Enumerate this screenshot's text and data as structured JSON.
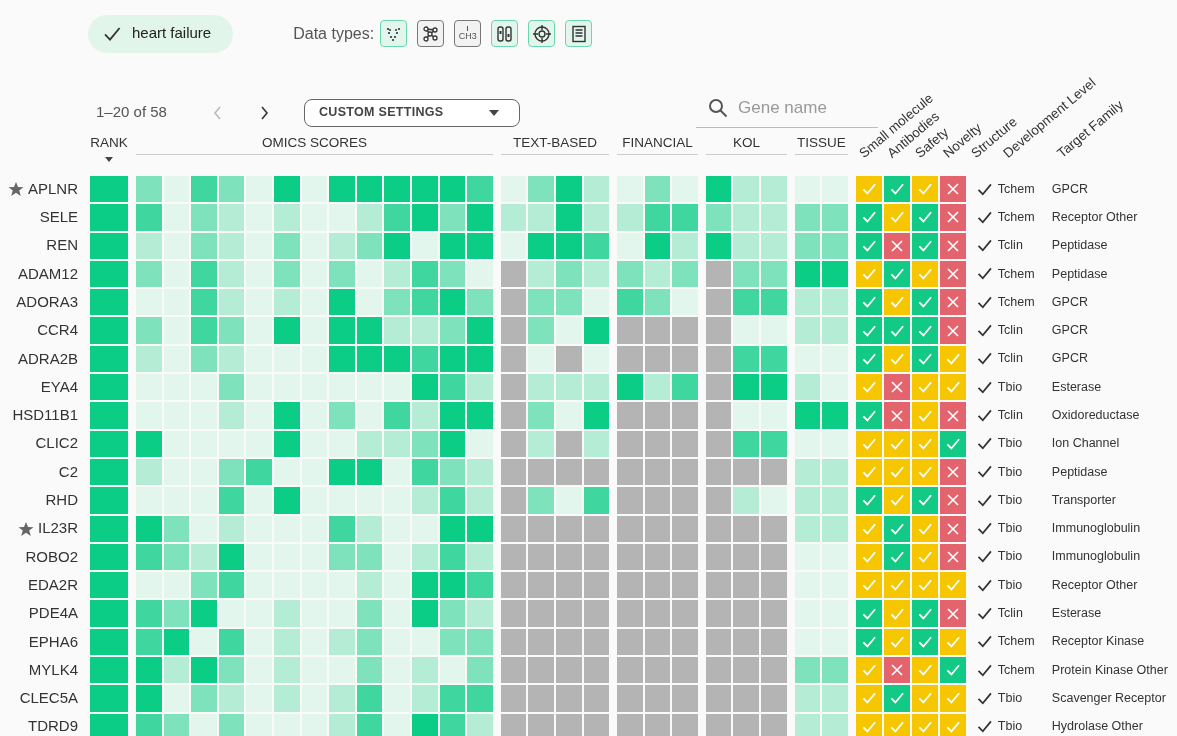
{
  "condition": {
    "label": "heart failure",
    "selected": true
  },
  "data_types_label": "Data types:",
  "data_types": [
    {
      "kind": "volcano",
      "selected": true
    },
    {
      "kind": "network",
      "selected": false
    },
    {
      "kind": "methyl",
      "label": "CH3",
      "selected": false
    },
    {
      "kind": "blots",
      "selected": true
    },
    {
      "kind": "target",
      "selected": true
    },
    {
      "kind": "document",
      "selected": true
    }
  ],
  "pagination": {
    "range": "1–20 of 58",
    "prev_disabled": true,
    "next_disabled": false
  },
  "settings_dropdown": {
    "label": "CUSTOM SETTINGS"
  },
  "search": {
    "placeholder": "Gene name"
  },
  "column_groups": [
    {
      "label": "RANK",
      "sorted": true
    },
    {
      "label": "OMICS SCORES",
      "sorted": false
    },
    {
      "label": "TEXT-BASED",
      "sorted": false
    },
    {
      "label": "FINANCIAL",
      "sorted": false
    },
    {
      "label": "KOL",
      "sorted": false
    },
    {
      "label": "TISSUE",
      "sorted": false
    }
  ],
  "rotated_headers": [
    "Small molecule",
    "Antibodies",
    "Safety",
    "Novelty",
    "Structure",
    "Development Level",
    "Target Family"
  ],
  "rows": [
    {
      "gene": "APLNR",
      "starred": true,
      "rank": {
        "kind": "full"
      },
      "omics": [
        {
          "kind": "medium"
        },
        {
          "kind": "faint"
        },
        {
          "kind": "strong"
        },
        {
          "kind": "medium"
        },
        {
          "kind": "faint"
        },
        {
          "kind": "full"
        },
        {
          "kind": "faint"
        },
        {
          "kind": "full"
        },
        {
          "kind": "full"
        },
        {
          "kind": "full"
        },
        {
          "kind": "full"
        },
        {
          "kind": "full"
        },
        {
          "kind": "strong"
        }
      ],
      "text_based": [
        {
          "kind": "faint"
        },
        {
          "kind": "medium"
        },
        {
          "kind": "full"
        },
        {
          "kind": "light"
        }
      ],
      "financial": [
        {
          "kind": "faint"
        },
        {
          "kind": "medium"
        },
        {
          "kind": "faint"
        }
      ],
      "kol": [
        {
          "kind": "full"
        },
        {
          "kind": "light"
        },
        {
          "kind": "light"
        }
      ],
      "tissue": [
        {
          "kind": "faint"
        },
        {
          "kind": "faint"
        }
      ],
      "tractability": [
        {
          "kind": "fair"
        },
        {
          "kind": "good"
        },
        {
          "kind": "fair"
        },
        {
          "kind": "none"
        }
      ],
      "structure_checked": true,
      "development_level": "Tchem",
      "target_family": "GPCR"
    },
    {
      "gene": "SELE",
      "starred": false,
      "rank": {
        "kind": "full"
      },
      "omics": [
        {
          "kind": "strong"
        },
        {
          "kind": "faint"
        },
        {
          "kind": "medium"
        },
        {
          "kind": "light"
        },
        {
          "kind": "faint"
        },
        {
          "kind": "light"
        },
        {
          "kind": "faint"
        },
        {
          "kind": "faint"
        },
        {
          "kind": "light"
        },
        {
          "kind": "strong"
        },
        {
          "kind": "full"
        },
        {
          "kind": "medium"
        },
        {
          "kind": "full"
        }
      ],
      "text_based": [
        {
          "kind": "light"
        },
        {
          "kind": "light"
        },
        {
          "kind": "full"
        },
        {
          "kind": "light"
        }
      ],
      "financial": [
        {
          "kind": "light"
        },
        {
          "kind": "strong"
        },
        {
          "kind": "strong"
        }
      ],
      "kol": [
        {
          "kind": "medium"
        },
        {
          "kind": "light"
        },
        {
          "kind": "light"
        }
      ],
      "tissue": [
        {
          "kind": "medium"
        },
        {
          "kind": "medium"
        }
      ],
      "tractability": [
        {
          "kind": "good"
        },
        {
          "kind": "fair"
        },
        {
          "kind": "good"
        },
        {
          "kind": "none"
        }
      ],
      "structure_checked": true,
      "development_level": "Tchem",
      "target_family": "Receptor Other"
    },
    {
      "gene": "REN",
      "starred": false,
      "rank": {
        "kind": "full"
      },
      "omics": [
        {
          "kind": "light"
        },
        {
          "kind": "faint"
        },
        {
          "kind": "medium"
        },
        {
          "kind": "light"
        },
        {
          "kind": "faint"
        },
        {
          "kind": "medium"
        },
        {
          "kind": "faint"
        },
        {
          "kind": "light"
        },
        {
          "kind": "medium"
        },
        {
          "kind": "full"
        },
        {
          "kind": "faint"
        },
        {
          "kind": "full"
        },
        {
          "kind": "full"
        }
      ],
      "text_based": [
        {
          "kind": "faint"
        },
        {
          "kind": "full"
        },
        {
          "kind": "full"
        },
        {
          "kind": "strong"
        }
      ],
      "financial": [
        {
          "kind": "faint"
        },
        {
          "kind": "full"
        },
        {
          "kind": "light"
        }
      ],
      "kol": [
        {
          "kind": "full"
        },
        {
          "kind": "light"
        },
        {
          "kind": "light"
        }
      ],
      "tissue": [
        {
          "kind": "medium"
        },
        {
          "kind": "medium"
        }
      ],
      "tractability": [
        {
          "kind": "good"
        },
        {
          "kind": "none"
        },
        {
          "kind": "good"
        },
        {
          "kind": "none"
        }
      ],
      "structure_checked": true,
      "development_level": "Tclin",
      "target_family": "Peptidase"
    },
    {
      "gene": "ADAM12",
      "starred": false,
      "rank": {
        "kind": "full"
      },
      "omics": [
        {
          "kind": "medium"
        },
        {
          "kind": "faint"
        },
        {
          "kind": "strong"
        },
        {
          "kind": "light"
        },
        {
          "kind": "faint"
        },
        {
          "kind": "medium"
        },
        {
          "kind": "faint"
        },
        {
          "kind": "medium"
        },
        {
          "kind": "faint"
        },
        {
          "kind": "light"
        },
        {
          "kind": "strong"
        },
        {
          "kind": "medium"
        },
        {
          "kind": "faint"
        }
      ],
      "text_based": [
        {
          "kind": "none"
        },
        {
          "kind": "light"
        },
        {
          "kind": "medium"
        },
        {
          "kind": "light"
        }
      ],
      "financial": [
        {
          "kind": "medium"
        },
        {
          "kind": "light"
        },
        {
          "kind": "medium"
        }
      ],
      "kol": [
        {
          "kind": "none"
        },
        {
          "kind": "medium"
        },
        {
          "kind": "medium"
        }
      ],
      "tissue": [
        {
          "kind": "full"
        },
        {
          "kind": "full"
        }
      ],
      "tractability": [
        {
          "kind": "fair"
        },
        {
          "kind": "good"
        },
        {
          "kind": "fair"
        },
        {
          "kind": "none"
        }
      ],
      "structure_checked": true,
      "development_level": "Tchem",
      "target_family": "Peptidase"
    },
    {
      "gene": "ADORA3",
      "starred": false,
      "rank": {
        "kind": "full"
      },
      "omics": [
        {
          "kind": "faint"
        },
        {
          "kind": "faint"
        },
        {
          "kind": "strong"
        },
        {
          "kind": "light"
        },
        {
          "kind": "faint"
        },
        {
          "kind": "light"
        },
        {
          "kind": "faint"
        },
        {
          "kind": "full"
        },
        {
          "kind": "faint"
        },
        {
          "kind": "medium"
        },
        {
          "kind": "strong"
        },
        {
          "kind": "full"
        },
        {
          "kind": "medium"
        }
      ],
      "text_based": [
        {
          "kind": "none"
        },
        {
          "kind": "medium"
        },
        {
          "kind": "medium"
        },
        {
          "kind": "faint"
        }
      ],
      "financial": [
        {
          "kind": "strong"
        },
        {
          "kind": "medium"
        },
        {
          "kind": "faint"
        }
      ],
      "kol": [
        {
          "kind": "none"
        },
        {
          "kind": "strong"
        },
        {
          "kind": "strong"
        }
      ],
      "tissue": [
        {
          "kind": "light"
        },
        {
          "kind": "light"
        }
      ],
      "tractability": [
        {
          "kind": "good"
        },
        {
          "kind": "fair"
        },
        {
          "kind": "good"
        },
        {
          "kind": "none"
        }
      ],
      "structure_checked": true,
      "development_level": "Tchem",
      "target_family": "GPCR"
    },
    {
      "gene": "CCR4",
      "starred": false,
      "rank": {
        "kind": "full"
      },
      "omics": [
        {
          "kind": "medium"
        },
        {
          "kind": "faint"
        },
        {
          "kind": "strong"
        },
        {
          "kind": "medium"
        },
        {
          "kind": "faint"
        },
        {
          "kind": "full"
        },
        {
          "kind": "faint"
        },
        {
          "kind": "full"
        },
        {
          "kind": "full"
        },
        {
          "kind": "light"
        },
        {
          "kind": "light"
        },
        {
          "kind": "medium"
        },
        {
          "kind": "full"
        }
      ],
      "text_based": [
        {
          "kind": "none"
        },
        {
          "kind": "medium"
        },
        {
          "kind": "faint"
        },
        {
          "kind": "full"
        }
      ],
      "financial": [
        {
          "kind": "none"
        },
        {
          "kind": "none"
        },
        {
          "kind": "none"
        }
      ],
      "kol": [
        {
          "kind": "none"
        },
        {
          "kind": "faint"
        },
        {
          "kind": "faint"
        }
      ],
      "tissue": [
        {
          "kind": "light"
        },
        {
          "kind": "light"
        }
      ],
      "tractability": [
        {
          "kind": "good"
        },
        {
          "kind": "good"
        },
        {
          "kind": "good"
        },
        {
          "kind": "none"
        }
      ],
      "structure_checked": true,
      "development_level": "Tclin",
      "target_family": "GPCR"
    },
    {
      "gene": "ADRA2B",
      "starred": false,
      "rank": {
        "kind": "full"
      },
      "omics": [
        {
          "kind": "light"
        },
        {
          "kind": "faint"
        },
        {
          "kind": "medium"
        },
        {
          "kind": "light"
        },
        {
          "kind": "faint"
        },
        {
          "kind": "faint"
        },
        {
          "kind": "faint"
        },
        {
          "kind": "full"
        },
        {
          "kind": "full"
        },
        {
          "kind": "full"
        },
        {
          "kind": "strong"
        },
        {
          "kind": "full"
        },
        {
          "kind": "full"
        }
      ],
      "text_based": [
        {
          "kind": "none"
        },
        {
          "kind": "faint"
        },
        {
          "kind": "none"
        },
        {
          "kind": "faint"
        }
      ],
      "financial": [
        {
          "kind": "none"
        },
        {
          "kind": "none"
        },
        {
          "kind": "none"
        }
      ],
      "kol": [
        {
          "kind": "none"
        },
        {
          "kind": "strong"
        },
        {
          "kind": "strong"
        }
      ],
      "tissue": [
        {
          "kind": "faint"
        },
        {
          "kind": "faint"
        }
      ],
      "tractability": [
        {
          "kind": "good"
        },
        {
          "kind": "fair"
        },
        {
          "kind": "good"
        },
        {
          "kind": "fair"
        }
      ],
      "structure_checked": true,
      "development_level": "Tclin",
      "target_family": "GPCR"
    },
    {
      "gene": "EYA4",
      "starred": false,
      "rank": {
        "kind": "full"
      },
      "omics": [
        {
          "kind": "faint"
        },
        {
          "kind": "faint"
        },
        {
          "kind": "faint"
        },
        {
          "kind": "medium"
        },
        {
          "kind": "faint"
        },
        {
          "kind": "faint"
        },
        {
          "kind": "faint"
        },
        {
          "kind": "faint"
        },
        {
          "kind": "faint"
        },
        {
          "kind": "faint"
        },
        {
          "kind": "full"
        },
        {
          "kind": "strong"
        },
        {
          "kind": "light"
        }
      ],
      "text_based": [
        {
          "kind": "none"
        },
        {
          "kind": "light"
        },
        {
          "kind": "light"
        },
        {
          "kind": "light"
        }
      ],
      "financial": [
        {
          "kind": "full"
        },
        {
          "kind": "light"
        },
        {
          "kind": "strong"
        }
      ],
      "kol": [
        {
          "kind": "none"
        },
        {
          "kind": "full"
        },
        {
          "kind": "full"
        }
      ],
      "tissue": [
        {
          "kind": "light"
        },
        {
          "kind": "faint"
        }
      ],
      "tractability": [
        {
          "kind": "fair"
        },
        {
          "kind": "none"
        },
        {
          "kind": "fair"
        },
        {
          "kind": "fair"
        }
      ],
      "structure_checked": true,
      "development_level": "Tbio",
      "target_family": "Esterase"
    },
    {
      "gene": "HSD11B1",
      "starred": false,
      "rank": {
        "kind": "full"
      },
      "omics": [
        {
          "kind": "faint"
        },
        {
          "kind": "faint"
        },
        {
          "kind": "faint"
        },
        {
          "kind": "light"
        },
        {
          "kind": "faint"
        },
        {
          "kind": "full"
        },
        {
          "kind": "faint"
        },
        {
          "kind": "medium"
        },
        {
          "kind": "faint"
        },
        {
          "kind": "strong"
        },
        {
          "kind": "light"
        },
        {
          "kind": "full"
        },
        {
          "kind": "full"
        }
      ],
      "text_based": [
        {
          "kind": "none"
        },
        {
          "kind": "medium"
        },
        {
          "kind": "faint"
        },
        {
          "kind": "full"
        }
      ],
      "financial": [
        {
          "kind": "none"
        },
        {
          "kind": "none"
        },
        {
          "kind": "none"
        }
      ],
      "kol": [
        {
          "kind": "none"
        },
        {
          "kind": "faint"
        },
        {
          "kind": "faint"
        }
      ],
      "tissue": [
        {
          "kind": "full"
        },
        {
          "kind": "full"
        }
      ],
      "tractability": [
        {
          "kind": "good"
        },
        {
          "kind": "none"
        },
        {
          "kind": "fair"
        },
        {
          "kind": "none"
        }
      ],
      "structure_checked": true,
      "development_level": "Tclin",
      "target_family": "Oxidoreductase"
    },
    {
      "gene": "CLIC2",
      "starred": false,
      "rank": {
        "kind": "full"
      },
      "omics": [
        {
          "kind": "full"
        },
        {
          "kind": "faint"
        },
        {
          "kind": "faint"
        },
        {
          "kind": "faint"
        },
        {
          "kind": "faint"
        },
        {
          "kind": "full"
        },
        {
          "kind": "faint"
        },
        {
          "kind": "faint"
        },
        {
          "kind": "light"
        },
        {
          "kind": "light"
        },
        {
          "kind": "medium"
        },
        {
          "kind": "full"
        },
        {
          "kind": "faint"
        }
      ],
      "text_based": [
        {
          "kind": "none"
        },
        {
          "kind": "light"
        },
        {
          "kind": "none"
        },
        {
          "kind": "light"
        }
      ],
      "financial": [
        {
          "kind": "none"
        },
        {
          "kind": "none"
        },
        {
          "kind": "none"
        }
      ],
      "kol": [
        {
          "kind": "none"
        },
        {
          "kind": "strong"
        },
        {
          "kind": "strong"
        }
      ],
      "tissue": [
        {
          "kind": "faint"
        },
        {
          "kind": "faint"
        }
      ],
      "tractability": [
        {
          "kind": "fair"
        },
        {
          "kind": "fair"
        },
        {
          "kind": "fair"
        },
        {
          "kind": "good"
        }
      ],
      "structure_checked": true,
      "development_level": "Tbio",
      "target_family": "Ion Channel"
    },
    {
      "gene": "C2",
      "starred": false,
      "rank": {
        "kind": "full"
      },
      "omics": [
        {
          "kind": "light"
        },
        {
          "kind": "faint"
        },
        {
          "kind": "faint"
        },
        {
          "kind": "medium"
        },
        {
          "kind": "strong"
        },
        {
          "kind": "faint"
        },
        {
          "kind": "faint"
        },
        {
          "kind": "full"
        },
        {
          "kind": "full"
        },
        {
          "kind": "faint"
        },
        {
          "kind": "strong"
        },
        {
          "kind": "medium"
        },
        {
          "kind": "light"
        }
      ],
      "text_based": [
        {
          "kind": "none"
        },
        {
          "kind": "none"
        },
        {
          "kind": "none"
        },
        {
          "kind": "none"
        }
      ],
      "financial": [
        {
          "kind": "none"
        },
        {
          "kind": "none"
        },
        {
          "kind": "none"
        }
      ],
      "kol": [
        {
          "kind": "none"
        },
        {
          "kind": "none"
        },
        {
          "kind": "none"
        }
      ],
      "tissue": [
        {
          "kind": "light"
        },
        {
          "kind": "light"
        }
      ],
      "tractability": [
        {
          "kind": "fair"
        },
        {
          "kind": "fair"
        },
        {
          "kind": "fair"
        },
        {
          "kind": "none"
        }
      ],
      "structure_checked": true,
      "development_level": "Tbio",
      "target_family": "Peptidase"
    },
    {
      "gene": "RHD",
      "starred": false,
      "rank": {
        "kind": "full"
      },
      "omics": [
        {
          "kind": "faint"
        },
        {
          "kind": "faint"
        },
        {
          "kind": "faint"
        },
        {
          "kind": "strong"
        },
        {
          "kind": "faint"
        },
        {
          "kind": "full"
        },
        {
          "kind": "faint"
        },
        {
          "kind": "faint"
        },
        {
          "kind": "faint"
        },
        {
          "kind": "faint"
        },
        {
          "kind": "light"
        },
        {
          "kind": "strong"
        },
        {
          "kind": "light"
        }
      ],
      "text_based": [
        {
          "kind": "none"
        },
        {
          "kind": "medium"
        },
        {
          "kind": "faint"
        },
        {
          "kind": "strong"
        }
      ],
      "financial": [
        {
          "kind": "none"
        },
        {
          "kind": "none"
        },
        {
          "kind": "none"
        }
      ],
      "kol": [
        {
          "kind": "none"
        },
        {
          "kind": "light"
        },
        {
          "kind": "faint"
        }
      ],
      "tissue": [
        {
          "kind": "light"
        },
        {
          "kind": "light"
        }
      ],
      "tractability": [
        {
          "kind": "good"
        },
        {
          "kind": "fair"
        },
        {
          "kind": "good"
        },
        {
          "kind": "none"
        }
      ],
      "structure_checked": true,
      "development_level": "Tbio",
      "target_family": "Transporter"
    },
    {
      "gene": "IL23R",
      "starred": true,
      "rank": {
        "kind": "full"
      },
      "omics": [
        {
          "kind": "full"
        },
        {
          "kind": "medium"
        },
        {
          "kind": "faint"
        },
        {
          "kind": "light"
        },
        {
          "kind": "faint"
        },
        {
          "kind": "faint"
        },
        {
          "kind": "faint"
        },
        {
          "kind": "strong"
        },
        {
          "kind": "light"
        },
        {
          "kind": "faint"
        },
        {
          "kind": "faint"
        },
        {
          "kind": "full"
        },
        {
          "kind": "full"
        }
      ],
      "text_based": [
        {
          "kind": "none"
        },
        {
          "kind": "none"
        },
        {
          "kind": "none"
        },
        {
          "kind": "none"
        }
      ],
      "financial": [
        {
          "kind": "none"
        },
        {
          "kind": "none"
        },
        {
          "kind": "none"
        }
      ],
      "kol": [
        {
          "kind": "none"
        },
        {
          "kind": "none"
        },
        {
          "kind": "none"
        }
      ],
      "tissue": [
        {
          "kind": "light"
        },
        {
          "kind": "light"
        }
      ],
      "tractability": [
        {
          "kind": "fair"
        },
        {
          "kind": "good"
        },
        {
          "kind": "fair"
        },
        {
          "kind": "none"
        }
      ],
      "structure_checked": true,
      "development_level": "Tbio",
      "target_family": "Immunoglobulin"
    },
    {
      "gene": "ROBO2",
      "starred": false,
      "rank": {
        "kind": "full"
      },
      "omics": [
        {
          "kind": "strong"
        },
        {
          "kind": "medium"
        },
        {
          "kind": "light"
        },
        {
          "kind": "full"
        },
        {
          "kind": "faint"
        },
        {
          "kind": "faint"
        },
        {
          "kind": "faint"
        },
        {
          "kind": "medium"
        },
        {
          "kind": "medium"
        },
        {
          "kind": "faint"
        },
        {
          "kind": "light"
        },
        {
          "kind": "strong"
        },
        {
          "kind": "light"
        }
      ],
      "text_based": [
        {
          "kind": "none"
        },
        {
          "kind": "none"
        },
        {
          "kind": "none"
        },
        {
          "kind": "none"
        }
      ],
      "financial": [
        {
          "kind": "none"
        },
        {
          "kind": "none"
        },
        {
          "kind": "none"
        }
      ],
      "kol": [
        {
          "kind": "none"
        },
        {
          "kind": "none"
        },
        {
          "kind": "none"
        }
      ],
      "tissue": [
        {
          "kind": "faint"
        },
        {
          "kind": "faint"
        }
      ],
      "tractability": [
        {
          "kind": "fair"
        },
        {
          "kind": "good"
        },
        {
          "kind": "fair"
        },
        {
          "kind": "none"
        }
      ],
      "structure_checked": true,
      "development_level": "Tbio",
      "target_family": "Immunoglobulin"
    },
    {
      "gene": "EDA2R",
      "starred": false,
      "rank": {
        "kind": "full"
      },
      "omics": [
        {
          "kind": "faint"
        },
        {
          "kind": "faint"
        },
        {
          "kind": "medium"
        },
        {
          "kind": "strong"
        },
        {
          "kind": "faint"
        },
        {
          "kind": "faint"
        },
        {
          "kind": "faint"
        },
        {
          "kind": "faint"
        },
        {
          "kind": "light"
        },
        {
          "kind": "faint"
        },
        {
          "kind": "full"
        },
        {
          "kind": "full"
        },
        {
          "kind": "strong"
        }
      ],
      "text_based": [
        {
          "kind": "none"
        },
        {
          "kind": "none"
        },
        {
          "kind": "none"
        },
        {
          "kind": "none"
        }
      ],
      "financial": [
        {
          "kind": "none"
        },
        {
          "kind": "none"
        },
        {
          "kind": "none"
        }
      ],
      "kol": [
        {
          "kind": "none"
        },
        {
          "kind": "none"
        },
        {
          "kind": "none"
        }
      ],
      "tissue": [
        {
          "kind": "faint"
        },
        {
          "kind": "faint"
        }
      ],
      "tractability": [
        {
          "kind": "fair"
        },
        {
          "kind": "fair"
        },
        {
          "kind": "fair"
        },
        {
          "kind": "fair"
        }
      ],
      "structure_checked": true,
      "development_level": "Tbio",
      "target_family": "Receptor Other"
    },
    {
      "gene": "PDE4A",
      "starred": false,
      "rank": {
        "kind": "full"
      },
      "omics": [
        {
          "kind": "strong"
        },
        {
          "kind": "medium"
        },
        {
          "kind": "full"
        },
        {
          "kind": "faint"
        },
        {
          "kind": "faint"
        },
        {
          "kind": "light"
        },
        {
          "kind": "faint"
        },
        {
          "kind": "faint"
        },
        {
          "kind": "medium"
        },
        {
          "kind": "faint"
        },
        {
          "kind": "full"
        },
        {
          "kind": "medium"
        },
        {
          "kind": "light"
        }
      ],
      "text_based": [
        {
          "kind": "none"
        },
        {
          "kind": "none"
        },
        {
          "kind": "none"
        },
        {
          "kind": "none"
        }
      ],
      "financial": [
        {
          "kind": "none"
        },
        {
          "kind": "none"
        },
        {
          "kind": "none"
        }
      ],
      "kol": [
        {
          "kind": "none"
        },
        {
          "kind": "none"
        },
        {
          "kind": "none"
        }
      ],
      "tissue": [
        {
          "kind": "faint"
        },
        {
          "kind": "faint"
        }
      ],
      "tractability": [
        {
          "kind": "good"
        },
        {
          "kind": "fair"
        },
        {
          "kind": "good"
        },
        {
          "kind": "none"
        }
      ],
      "structure_checked": true,
      "development_level": "Tclin",
      "target_family": "Esterase"
    },
    {
      "gene": "EPHA6",
      "starred": false,
      "rank": {
        "kind": "full"
      },
      "omics": [
        {
          "kind": "strong"
        },
        {
          "kind": "full"
        },
        {
          "kind": "faint"
        },
        {
          "kind": "strong"
        },
        {
          "kind": "faint"
        },
        {
          "kind": "light"
        },
        {
          "kind": "faint"
        },
        {
          "kind": "light"
        },
        {
          "kind": "medium"
        },
        {
          "kind": "faint"
        },
        {
          "kind": "faint"
        },
        {
          "kind": "medium"
        },
        {
          "kind": "medium"
        }
      ],
      "text_based": [
        {
          "kind": "none"
        },
        {
          "kind": "none"
        },
        {
          "kind": "none"
        },
        {
          "kind": "none"
        }
      ],
      "financial": [
        {
          "kind": "none"
        },
        {
          "kind": "none"
        },
        {
          "kind": "none"
        }
      ],
      "kol": [
        {
          "kind": "none"
        },
        {
          "kind": "none"
        },
        {
          "kind": "none"
        }
      ],
      "tissue": [
        {
          "kind": "faint"
        },
        {
          "kind": "faint"
        }
      ],
      "tractability": [
        {
          "kind": "good"
        },
        {
          "kind": "fair"
        },
        {
          "kind": "good"
        },
        {
          "kind": "fair"
        }
      ],
      "structure_checked": true,
      "development_level": "Tchem",
      "target_family": "Receptor Kinase"
    },
    {
      "gene": "MYLK4",
      "starred": false,
      "rank": {
        "kind": "full"
      },
      "omics": [
        {
          "kind": "full"
        },
        {
          "kind": "light"
        },
        {
          "kind": "full"
        },
        {
          "kind": "medium"
        },
        {
          "kind": "faint"
        },
        {
          "kind": "light"
        },
        {
          "kind": "faint"
        },
        {
          "kind": "faint"
        },
        {
          "kind": "medium"
        },
        {
          "kind": "faint"
        },
        {
          "kind": "light"
        },
        {
          "kind": "faint"
        },
        {
          "kind": "medium"
        }
      ],
      "text_based": [
        {
          "kind": "none"
        },
        {
          "kind": "none"
        },
        {
          "kind": "none"
        },
        {
          "kind": "none"
        }
      ],
      "financial": [
        {
          "kind": "none"
        },
        {
          "kind": "none"
        },
        {
          "kind": "none"
        }
      ],
      "kol": [
        {
          "kind": "none"
        },
        {
          "kind": "none"
        },
        {
          "kind": "none"
        }
      ],
      "tissue": [
        {
          "kind": "medium"
        },
        {
          "kind": "medium"
        }
      ],
      "tractability": [
        {
          "kind": "fair"
        },
        {
          "kind": "none"
        },
        {
          "kind": "fair"
        },
        {
          "kind": "good"
        }
      ],
      "structure_checked": true,
      "development_level": "Tchem",
      "target_family": "Protein Kinase Other"
    },
    {
      "gene": "CLEC5A",
      "starred": false,
      "rank": {
        "kind": "full"
      },
      "omics": [
        {
          "kind": "full"
        },
        {
          "kind": "faint"
        },
        {
          "kind": "medium"
        },
        {
          "kind": "light"
        },
        {
          "kind": "faint"
        },
        {
          "kind": "light"
        },
        {
          "kind": "faint"
        },
        {
          "kind": "light"
        },
        {
          "kind": "strong"
        },
        {
          "kind": "faint"
        },
        {
          "kind": "light"
        },
        {
          "kind": "strong"
        },
        {
          "kind": "strong"
        }
      ],
      "text_based": [
        {
          "kind": "none"
        },
        {
          "kind": "none"
        },
        {
          "kind": "none"
        },
        {
          "kind": "none"
        }
      ],
      "financial": [
        {
          "kind": "none"
        },
        {
          "kind": "none"
        },
        {
          "kind": "none"
        }
      ],
      "kol": [
        {
          "kind": "none"
        },
        {
          "kind": "none"
        },
        {
          "kind": "none"
        }
      ],
      "tissue": [
        {
          "kind": "light"
        },
        {
          "kind": "light"
        }
      ],
      "tractability": [
        {
          "kind": "fair"
        },
        {
          "kind": "good"
        },
        {
          "kind": "fair"
        },
        {
          "kind": "fair"
        }
      ],
      "structure_checked": true,
      "development_level": "Tbio",
      "target_family": "Scavenger Receptor"
    },
    {
      "gene": "TDRD9",
      "starred": false,
      "rank": {
        "kind": "full"
      },
      "omics": [
        {
          "kind": "strong"
        },
        {
          "kind": "medium"
        },
        {
          "kind": "faint"
        },
        {
          "kind": "medium"
        },
        {
          "kind": "faint"
        },
        {
          "kind": "faint"
        },
        {
          "kind": "faint"
        },
        {
          "kind": "light"
        },
        {
          "kind": "strong"
        },
        {
          "kind": "faint"
        },
        {
          "kind": "full"
        },
        {
          "kind": "strong"
        },
        {
          "kind": "light"
        }
      ],
      "text_based": [
        {
          "kind": "none"
        },
        {
          "kind": "none"
        },
        {
          "kind": "none"
        },
        {
          "kind": "none"
        }
      ],
      "financial": [
        {
          "kind": "none"
        },
        {
          "kind": "none"
        },
        {
          "kind": "none"
        }
      ],
      "kol": [
        {
          "kind": "none"
        },
        {
          "kind": "none"
        },
        {
          "kind": "none"
        }
      ],
      "tissue": [
        {
          "kind": "light"
        },
        {
          "kind": "light"
        }
      ],
      "tractability": [
        {
          "kind": "fair"
        },
        {
          "kind": "fair"
        },
        {
          "kind": "fair"
        },
        {
          "kind": "fair"
        }
      ],
      "structure_checked": true,
      "development_level": "Tbio",
      "target_family": "Hydrolase Other"
    }
  ]
}
